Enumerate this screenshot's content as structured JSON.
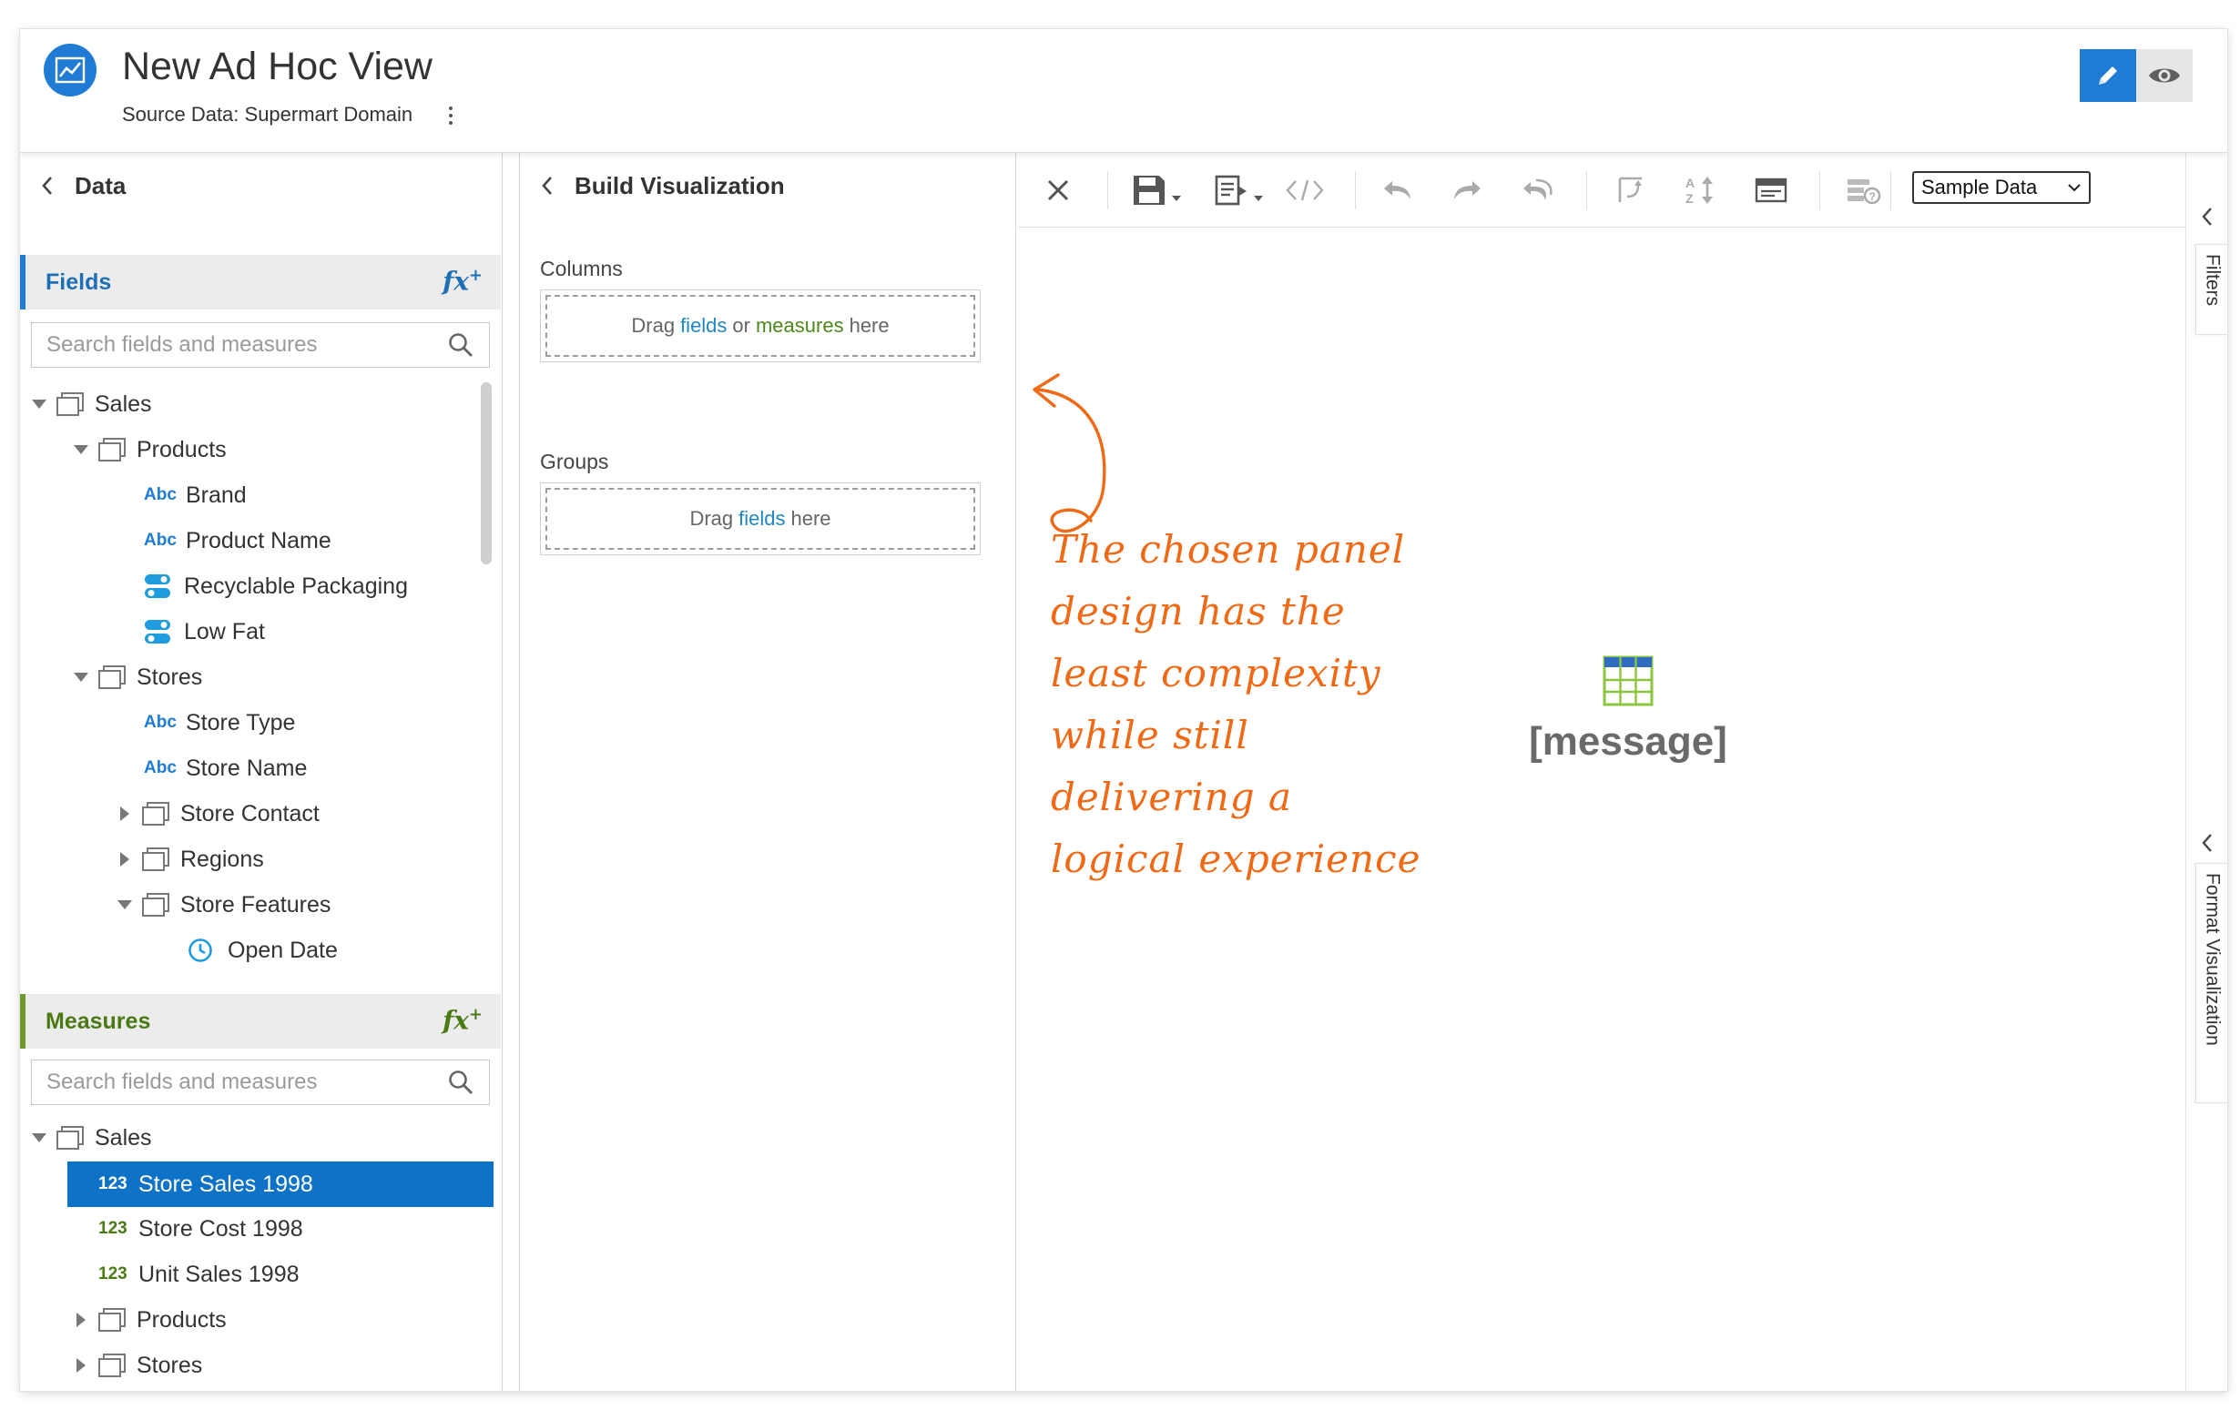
{
  "header": {
    "title": "New Ad Hoc View",
    "source_label": "Source Data: Supermart Domain"
  },
  "data_panel": {
    "title": "Data",
    "fields": {
      "label": "Fields",
      "fx_label": "fx",
      "search_placeholder": "Search fields and measures",
      "tree": [
        {
          "label": "Sales",
          "type": "folder",
          "expanded": true
        },
        {
          "label": "Products",
          "type": "folder",
          "expanded": true
        },
        {
          "label": "Brand",
          "type": "text"
        },
        {
          "label": "Product Name",
          "type": "text"
        },
        {
          "label": "Recyclable Packaging",
          "type": "boolean"
        },
        {
          "label": "Low Fat",
          "type": "boolean"
        },
        {
          "label": "Stores",
          "type": "folder",
          "expanded": true
        },
        {
          "label": "Store Type",
          "type": "text"
        },
        {
          "label": "Store Name",
          "type": "text"
        },
        {
          "label": "Store Contact",
          "type": "folder",
          "expanded": false
        },
        {
          "label": "Regions",
          "type": "folder",
          "expanded": false
        },
        {
          "label": "Store Features",
          "type": "folder",
          "expanded": true
        },
        {
          "label": "Open Date",
          "type": "date"
        }
      ]
    },
    "measures": {
      "label": "Measures",
      "fx_label": "fx",
      "search_placeholder": "Search fields and measures",
      "tree": [
        {
          "label": "Sales",
          "type": "folder",
          "expanded": true
        },
        {
          "label": "Store Sales 1998",
          "type": "number",
          "selected": true
        },
        {
          "label": "Store Cost 1998",
          "type": "number"
        },
        {
          "label": "Unit Sales 1998",
          "type": "number"
        },
        {
          "label": "Products",
          "type": "folder",
          "expanded": false
        },
        {
          "label": "Stores",
          "type": "folder",
          "expanded": false
        }
      ]
    },
    "type_badges": {
      "text": "Abc",
      "number": "123"
    }
  },
  "build_panel": {
    "title": "Build Visualization",
    "columns_label": "Columns",
    "columns_drop": {
      "pre": "Drag",
      "fields": "fields",
      "or": "or",
      "measures": "measures",
      "post": "here"
    },
    "groups_label": "Groups",
    "groups_drop": {
      "pre": "Drag",
      "fields": "fields",
      "post": "here"
    }
  },
  "toolbar": {
    "icons": [
      "close-icon",
      "save-icon",
      "export-icon",
      "code-icon",
      "undo-icon",
      "redo-icon",
      "undo-all-icon",
      "switch-icon",
      "sort-icon",
      "layout-icon",
      "query-icon"
    ],
    "sample_select": "Sample Data"
  },
  "canvas": {
    "message": "[message]",
    "annotation": "The chosen panel\ndesign has the\nleast complexity\nwhile still\ndelivering a\nlogical experience"
  },
  "side_tabs": {
    "filters": "Filters",
    "format": "Format Visualization"
  },
  "colors": {
    "accent": "#1f7bd4",
    "measures_green": "#4b7a15",
    "annotation": "#f06a16",
    "selected": "#0e73c6"
  }
}
